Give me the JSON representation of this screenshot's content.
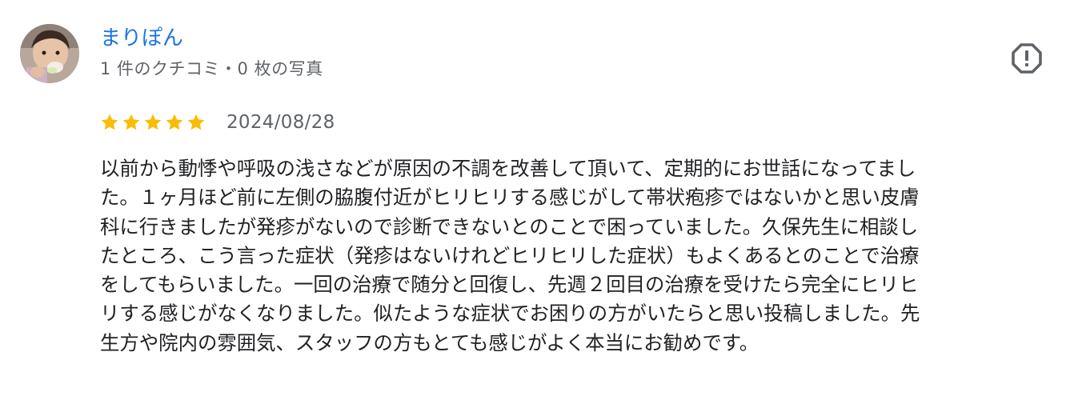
{
  "reviewer": {
    "name": "まりぽん",
    "meta": "1 件のクチコミ・0 枚の写真"
  },
  "review": {
    "rating": 5,
    "rating_max": 5,
    "date": "2024/08/28",
    "text_lines": [
      "以前から動悸や呼吸の浅さなどが原因の不調を改善して頂いて、定期的にお世話になってまし",
      "た。１ヶ月ほど前に左側の脇腹付近がヒリヒリする感じがして帯状疱疹ではないかと思い皮膚",
      "科に行きましたが発疹がないので診断できないとのことで困っていました。久保先生に相談し",
      "たところ、こう言った症状（発疹はないけれどヒリヒリした症状）もよくあるとのことで治療",
      "をしてもらいました。一回の治療で随分と回復し、先週２回目の治療を受けたら完全にヒリヒ",
      "リする感じがなくなりました。似たような症状でお困りの方がいたらと思い投稿しました。先",
      "生方や院内の雰囲気、スタッフの方もとても感じがよく本当にお勧めです。"
    ]
  },
  "icons": {
    "flag": "report-flag-icon",
    "star": "star-icon"
  },
  "colors": {
    "name_link": "#1a73e8",
    "meta_text": "#5f6368",
    "body_text": "#202124",
    "star_fill": "#fbbc04",
    "flag_icon": "#5f6368"
  }
}
